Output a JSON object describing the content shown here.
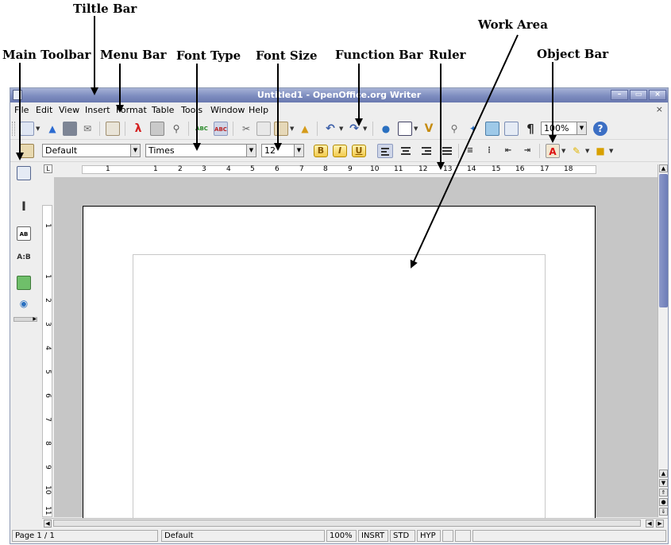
{
  "callouts": {
    "title_bar": "Tiltle Bar",
    "main_toolbar": "Main Toolbar",
    "menu_bar": "Menu Bar",
    "font_type": "Font Type",
    "font_size": "Font Size",
    "function_bar": "Function Bar",
    "ruler": "Ruler",
    "object_bar": "Object Bar",
    "work_area": "Work Area"
  },
  "window": {
    "title": "Untitled1 - OpenOffice.org Writer",
    "controls": {
      "minimize": "–",
      "maximize": "▭",
      "close": "×"
    },
    "doc_close": "×"
  },
  "menu": {
    "items": [
      "File",
      "Edit",
      "View",
      "Insert",
      "Format",
      "Table",
      "Tools",
      "Window",
      "Help"
    ]
  },
  "function_bar": {
    "zoom_value": "100%",
    "icons": [
      "new-icon",
      "open-icon",
      "save-icon",
      "email-icon",
      "edit-file-icon",
      "export-pdf-icon",
      "print-icon",
      "page-preview-icon",
      "spellcheck-icon",
      "autospellcheck-icon",
      "cut-icon",
      "copy-icon",
      "paste-icon",
      "format-paintbrush-icon",
      "undo-icon",
      "redo-icon",
      "hyperlink-icon",
      "table-icon",
      "draw-functions-icon",
      "find-replace-icon",
      "navigator-icon",
      "gallery-icon",
      "data-sources-icon",
      "nonprinting-chars-icon",
      "zoom-icon",
      "help-icon"
    ]
  },
  "formatting_bar": {
    "style_value": "Default",
    "font_value": "Times",
    "size_value": "12",
    "bold": "B",
    "italic": "I",
    "underline": "U"
  },
  "ruler": {
    "corner": "L",
    "numbers": [
      "1",
      "1",
      "2",
      "3",
      "4",
      "5",
      "6",
      "7",
      "8",
      "9",
      "10",
      "11",
      "12",
      "13",
      "14",
      "15",
      "16",
      "17",
      "18"
    ]
  },
  "vruler": {
    "numbers": [
      "1",
      "1",
      "2",
      "3",
      "4",
      "5",
      "6",
      "7",
      "8",
      "9",
      "10",
      "11"
    ]
  },
  "statusbar": {
    "page": "Page 1 / 1",
    "style": "Default",
    "zoom": "100%",
    "insert_mode": "INSRT",
    "selection_mode": "STD",
    "hyperlink_mode": "HYP"
  },
  "colors": {
    "titlebar": "#7d8cbf",
    "scroll_thumb": "#6c7cb7",
    "workarea_bg": "#c6c6c6"
  }
}
